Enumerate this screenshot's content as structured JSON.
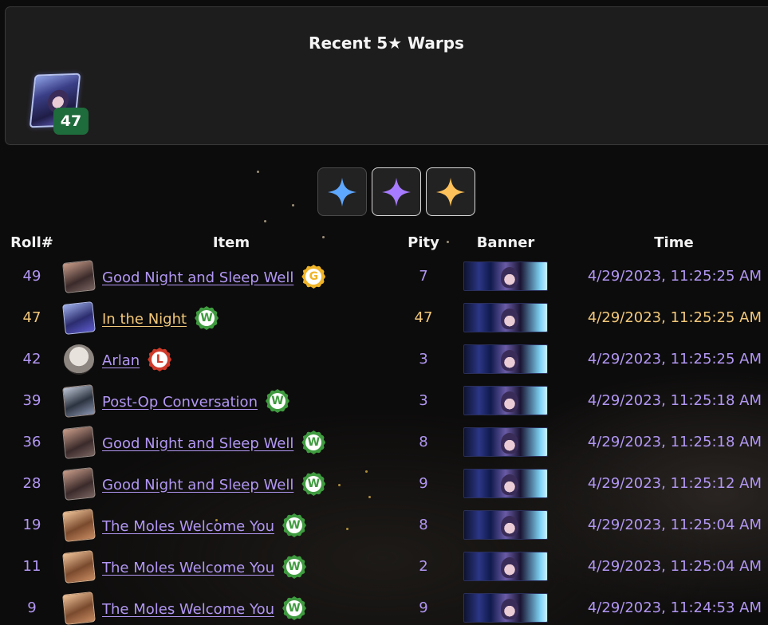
{
  "recent": {
    "title": "Recent 5★ Warps",
    "items": [
      {
        "name": "In the Night",
        "pity": "47",
        "icon": "in-the-night-portrait"
      }
    ]
  },
  "filters": [
    {
      "name": "3-star-filter",
      "color": "#5ea8ff",
      "active": false
    },
    {
      "name": "4-star-filter",
      "color": "#a77bff",
      "active": true
    },
    {
      "name": "5-star-filter",
      "color": "#ffc15a",
      "active": true
    }
  ],
  "table": {
    "headers": {
      "roll": "Roll#",
      "item": "Item",
      "pity": "Pity",
      "banner": "Banner",
      "time": "Time"
    },
    "rows": [
      {
        "roll": "49",
        "item": "Good Night and Sleep Well",
        "tag": "G",
        "tag_color": "#f0b428",
        "pity": "7",
        "time": "4/29/2023, 11:25:25 AM",
        "rarity": 4,
        "icon": "good-night-icon"
      },
      {
        "roll": "47",
        "item": "In the Night",
        "tag": "W",
        "tag_color": "#3f9b3f",
        "pity": "47",
        "time": "4/29/2023, 11:25:25 AM",
        "rarity": 5,
        "icon": "in-the-night-icon"
      },
      {
        "roll": "42",
        "item": "Arlan",
        "tag": "L",
        "tag_color": "#d03a2a",
        "pity": "3",
        "time": "4/29/2023, 11:25:25 AM",
        "rarity": 4,
        "icon": "arlan-icon"
      },
      {
        "roll": "39",
        "item": "Post-Op Conversation",
        "tag": "W",
        "tag_color": "#3f9b3f",
        "pity": "3",
        "time": "4/29/2023, 11:25:18 AM",
        "rarity": 4,
        "icon": "post-op-icon"
      },
      {
        "roll": "36",
        "item": "Good Night and Sleep Well",
        "tag": "W",
        "tag_color": "#3f9b3f",
        "pity": "8",
        "time": "4/29/2023, 11:25:18 AM",
        "rarity": 4,
        "icon": "good-night-icon"
      },
      {
        "roll": "28",
        "item": "Good Night and Sleep Well",
        "tag": "W",
        "tag_color": "#3f9b3f",
        "pity": "9",
        "time": "4/29/2023, 11:25:12 AM",
        "rarity": 4,
        "icon": "good-night-icon"
      },
      {
        "roll": "19",
        "item": "The Moles Welcome You",
        "tag": "W",
        "tag_color": "#3f9b3f",
        "pity": "8",
        "time": "4/29/2023, 11:25:04 AM",
        "rarity": 4,
        "icon": "moles-icon"
      },
      {
        "roll": "11",
        "item": "The Moles Welcome You",
        "tag": "W",
        "tag_color": "#3f9b3f",
        "pity": "2",
        "time": "4/29/2023, 11:25:04 AM",
        "rarity": 4,
        "icon": "moles-icon"
      },
      {
        "roll": "9",
        "item": "The Moles Welcome You",
        "tag": "W",
        "tag_color": "#3f9b3f",
        "pity": "9",
        "time": "4/29/2023, 11:24:53 AM",
        "rarity": 4,
        "icon": "moles-icon"
      }
    ]
  }
}
